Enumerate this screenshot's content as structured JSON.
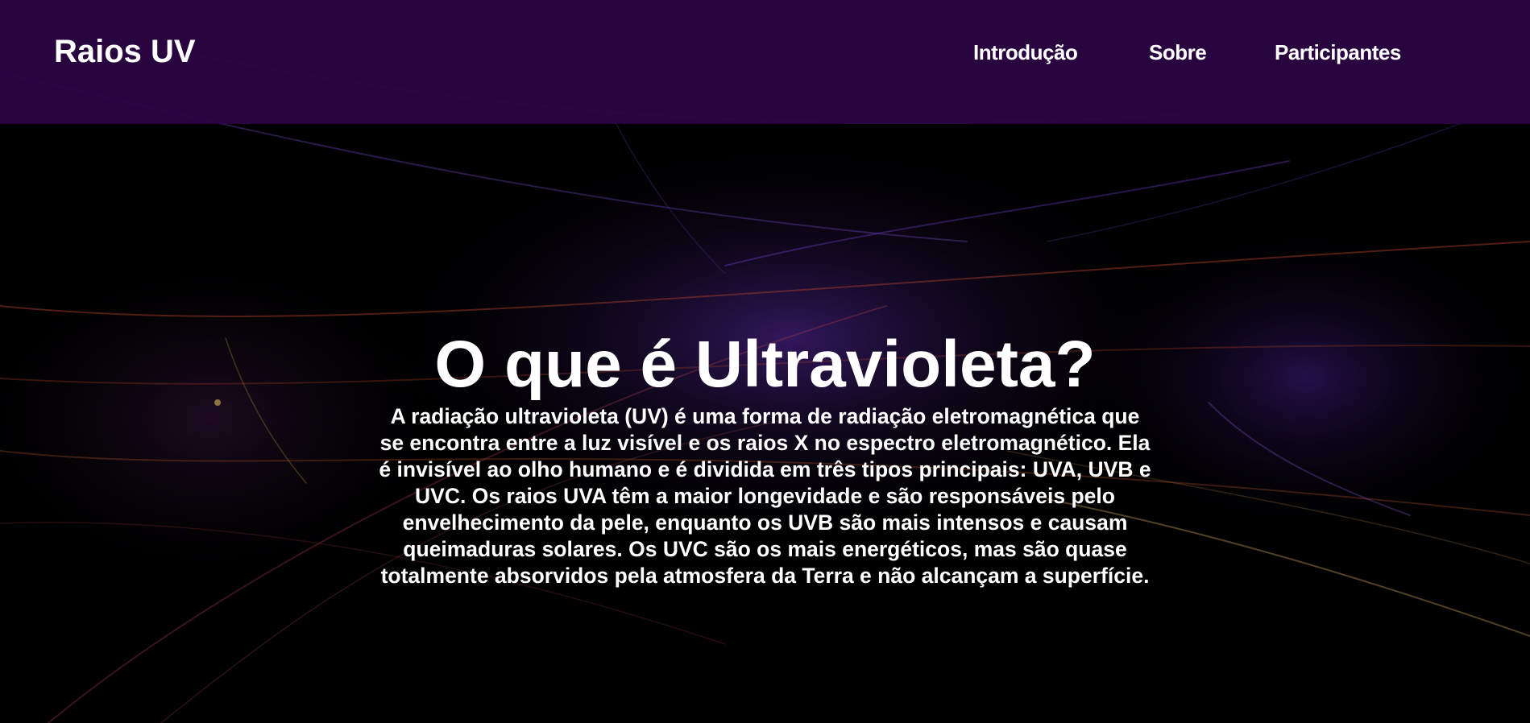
{
  "header": {
    "brand": "Raios UV",
    "nav": [
      {
        "label": "Introdução"
      },
      {
        "label": "Sobre"
      },
      {
        "label": "Participantes"
      }
    ]
  },
  "hero": {
    "title": "O que é Ultravioleta?",
    "text": "A radiação ultravioleta (UV) é uma forma de radiação eletromagnética que se encontra entre a luz visível e os raios X no espectro eletromagnético. Ela é invisível ao olho humano e é dividida em três tipos principais: UVA, UVB e UVC. Os raios UVA têm a maior longevidade e são responsáveis pelo envelhecimento da pele, enquanto os UVB são mais intensos e causam queimaduras solares. Os UVC são os mais energéticos, mas são quase totalmente absorvidos pela atmosfera da Terra e não alcançam a superfície."
  },
  "colors": {
    "header_bg": "#2c0544",
    "page_bg": "#000000",
    "text": "#ffffff",
    "accent_purple": "#6a2fd0",
    "accent_orange": "#c8502a"
  }
}
